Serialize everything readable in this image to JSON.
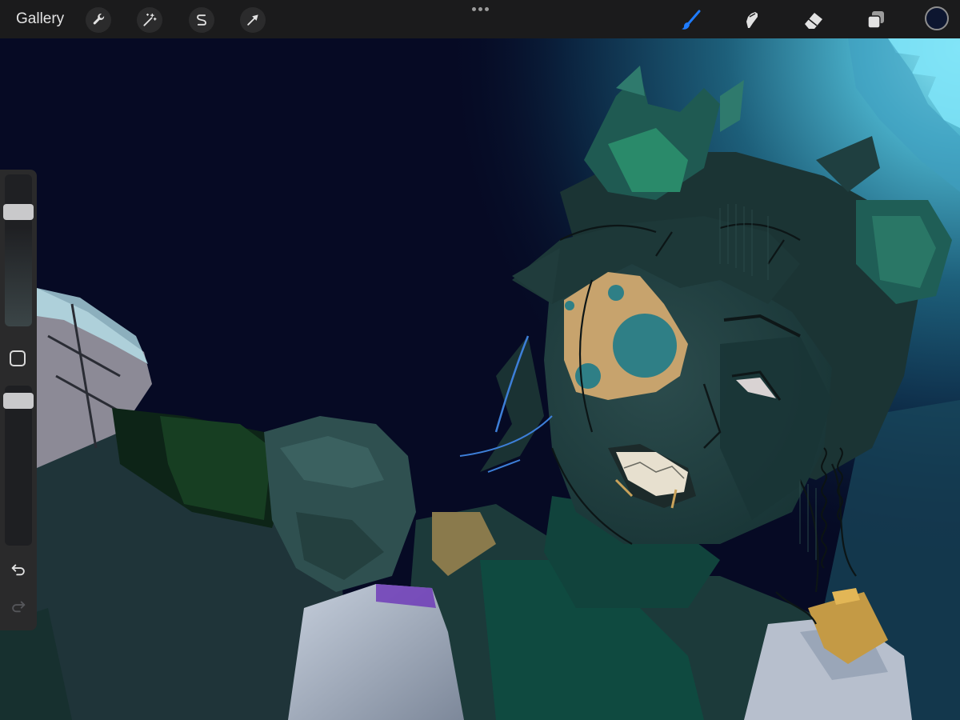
{
  "toolbar": {
    "gallery_label": "Gallery",
    "left_tools": [
      "wrench-icon",
      "magic-wand-icon",
      "selection-s-icon",
      "arrow-cursor-icon"
    ],
    "more_icon": "more-dots-icon",
    "right_tools": [
      "brush-icon",
      "smudge-icon",
      "eraser-icon",
      "layers-icon"
    ],
    "active_tool": "brush",
    "active_color": "#0d1630",
    "accent_color": "#1f7cff"
  },
  "sidebar": {
    "brush_size_level": 0.78,
    "opacity_level": 0.95,
    "modify_icon": "modify-square-icon",
    "undo_icon": "undo-icon",
    "redo_icon": "redo-icon",
    "redo_enabled": false
  }
}
